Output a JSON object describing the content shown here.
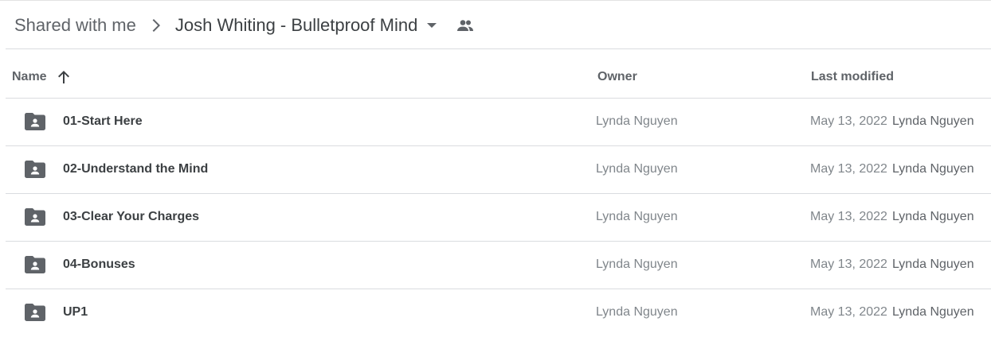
{
  "breadcrumb": {
    "root": "Shared with me",
    "current": "Josh Whiting - Bulletproof Mind",
    "icons": [
      "chevron-right-icon",
      "caret-down-icon",
      "shared-people-icon"
    ]
  },
  "columns": {
    "name": "Name",
    "owner": "Owner",
    "modified": "Last modified",
    "sort_icon": "arrow-up-icon"
  },
  "colors": {
    "folder_icon": "#5f6368",
    "divider": "#dadce0"
  },
  "rows": [
    {
      "name": "01-Start Here",
      "owner": "Lynda Nguyen",
      "modified": "May 13, 2022",
      "modified_by": "Lynda Nguyen",
      "icon": "shared-folder-icon"
    },
    {
      "name": "02-Understand the Mind",
      "owner": "Lynda Nguyen",
      "modified": "May 13, 2022",
      "modified_by": "Lynda Nguyen",
      "icon": "shared-folder-icon"
    },
    {
      "name": "03-Clear Your Charges",
      "owner": "Lynda Nguyen",
      "modified": "May 13, 2022",
      "modified_by": "Lynda Nguyen",
      "icon": "shared-folder-icon"
    },
    {
      "name": "04-Bonuses",
      "owner": "Lynda Nguyen",
      "modified": "May 13, 2022",
      "modified_by": "Lynda Nguyen",
      "icon": "shared-folder-icon"
    },
    {
      "name": "UP1",
      "owner": "Lynda Nguyen",
      "modified": "May 13, 2022",
      "modified_by": "Lynda Nguyen",
      "icon": "shared-folder-icon"
    }
  ]
}
